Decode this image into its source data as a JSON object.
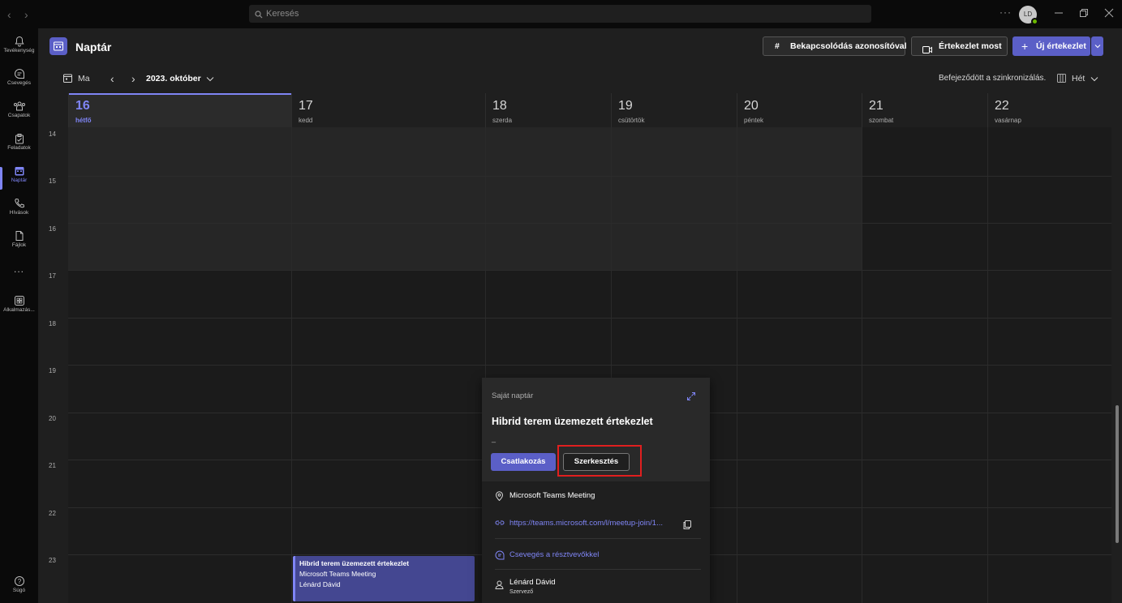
{
  "titlebar": {
    "search_placeholder": "Keresés",
    "avatar_initials": "LD"
  },
  "rail": {
    "items": [
      {
        "label": "Tevékenység",
        "icon": "bell-icon"
      },
      {
        "label": "Csevegés",
        "icon": "chat-icon"
      },
      {
        "label": "Csapatok",
        "icon": "teams-icon"
      },
      {
        "label": "Feladatok",
        "icon": "tasks-icon"
      },
      {
        "label": "Naptár",
        "icon": "calendar-icon",
        "active": true
      },
      {
        "label": "Hívások",
        "icon": "phone-icon"
      },
      {
        "label": "Fájlok",
        "icon": "file-icon"
      },
      {
        "label": "...",
        "icon": "more-icon"
      },
      {
        "label": "Alkalmazás...",
        "icon": "apps-icon"
      }
    ],
    "help_label": "Súgó"
  },
  "header": {
    "title": "Naptár",
    "join_with_id": "Bekapcsolódás azonosítóval",
    "meet_now": "Értekezlet most",
    "new_meeting": "Új értekezlet"
  },
  "toolbar": {
    "today": "Ma",
    "month": "2023. október",
    "sync_status": "Befejeződött a szinkronizálás.",
    "view": "Hét"
  },
  "days": [
    {
      "num": "16",
      "name": "hétfő",
      "today": true
    },
    {
      "num": "17",
      "name": "kedd"
    },
    {
      "num": "18",
      "name": "szerda"
    },
    {
      "num": "19",
      "name": "csütörtök"
    },
    {
      "num": "20",
      "name": "péntek"
    },
    {
      "num": "21",
      "name": "szombat"
    },
    {
      "num": "22",
      "name": "vasárnap"
    }
  ],
  "hours": [
    "14",
    "15",
    "16",
    "17",
    "18",
    "19",
    "20",
    "21",
    "22",
    "23"
  ],
  "event": {
    "title": "Hibrid terem üzemezett értekezlet",
    "location": "Microsoft Teams Meeting",
    "organizer": "Lénárd Dávid"
  },
  "popup": {
    "calendar": "Saját naptár",
    "title": "Hibrid terem üzemezett értekezlet",
    "subtitle": "_",
    "join": "Csatlakozás",
    "edit": "Szerkesztés",
    "location": "Microsoft Teams Meeting",
    "link": "https://teams.microsoft.com/l/meetup-join/1...",
    "chat": "Csevegés a résztvevőkkel",
    "organizer_name": "Lénárd Dávid",
    "organizer_role": "Szervező"
  },
  "colors": {
    "accent": "#5b5fc7",
    "accent_light": "#7f85f5",
    "highlight": "#e01f1f"
  }
}
